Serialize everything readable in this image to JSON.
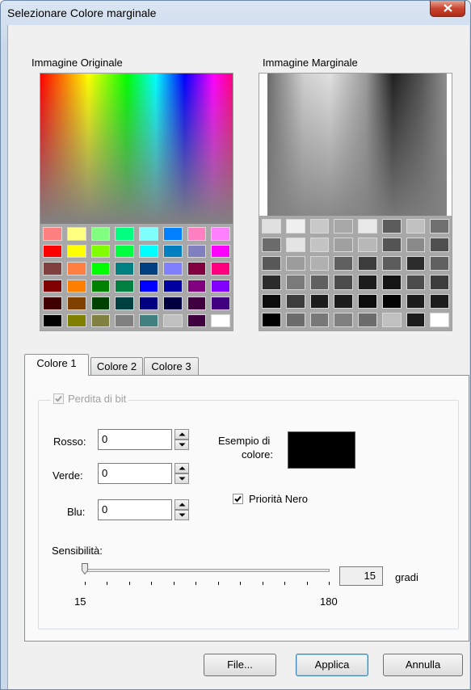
{
  "window": {
    "title": "Selezionare Colore marginale"
  },
  "images": {
    "original_label": "Immagine Originale",
    "marginal_label": "Immagine Marginale",
    "original_swatches": [
      [
        "#ff8080",
        "#ffff80",
        "#80ff80",
        "#00ff80",
        "#80ffff",
        "#0080ff",
        "#ff80c0",
        "#ff80ff"
      ],
      [
        "#ff0000",
        "#ffff00",
        "#80ff00",
        "#00ff40",
        "#00ffff",
        "#0080c0",
        "#8080c0",
        "#ff00ff"
      ],
      [
        "#804040",
        "#ff8040",
        "#00ff00",
        "#008080",
        "#004080",
        "#8080ff",
        "#800040",
        "#ff0080"
      ],
      [
        "#800000",
        "#ff8000",
        "#008000",
        "#008040",
        "#0000ff",
        "#0000a0",
        "#800080",
        "#8000ff"
      ],
      [
        "#400000",
        "#804000",
        "#004000",
        "#004040",
        "#000080",
        "#000040",
        "#400040",
        "#400080"
      ],
      [
        "#000000",
        "#808000",
        "#808040",
        "#808080",
        "#408080",
        "#c0c0c0",
        "#400040",
        "#ffffff"
      ]
    ],
    "marginal_swatches": [
      [
        "#e0e0e0",
        "#f0f0f0",
        "#c8c8c8",
        "#a8a8a8",
        "#e8e8e8",
        "#5c5c5c",
        "#c0c0c0",
        "#707070"
      ],
      [
        "#6c6c6c",
        "#e4e4e4",
        "#c4c4c4",
        "#a0a0a0",
        "#b8b8b8",
        "#545454",
        "#8a8a8a",
        "#505050"
      ],
      [
        "#585858",
        "#9c9c9c",
        "#b0b0b0",
        "#606060",
        "#3c3c3c",
        "#5c5c5c",
        "#2c2c2c",
        "#606060"
      ],
      [
        "#2c2c2c",
        "#7a7a7a",
        "#606060",
        "#4c4c4c",
        "#1c1c1c",
        "#141414",
        "#4c4c4c",
        "#3c3c3c"
      ],
      [
        "#0c0c0c",
        "#3c3c3c",
        "#1c1c1c",
        "#1c1c1c",
        "#0c0c0c",
        "#040404",
        "#1c1c1c",
        "#1c1c1c"
      ],
      [
        "#000000",
        "#6c6c6c",
        "#787878",
        "#808080",
        "#6c6c6c",
        "#c0c0c0",
        "#1c1c1c",
        "#ffffff"
      ]
    ]
  },
  "tabs": [
    {
      "label": "Colore 1",
      "active": true
    },
    {
      "label": "Colore 2",
      "active": false
    },
    {
      "label": "Colore 3",
      "active": false
    }
  ],
  "group": {
    "label": "Perdita di bit",
    "checked": true,
    "disabled": true
  },
  "fields": {
    "red_label": "Rosso:",
    "red_value": "0",
    "green_label": "Verde:",
    "green_value": "0",
    "blue_label": "Blu:",
    "blue_value": "0"
  },
  "sample": {
    "label_line1": "Esempio di",
    "label_line2": "colore:",
    "color": "#000000"
  },
  "black_priority": {
    "label": "Priorità Nero",
    "checked": true
  },
  "sensitivity": {
    "label": "Sensibilità:",
    "min_label": "15",
    "max_label": "180",
    "min": 15,
    "max": 180,
    "value": 15,
    "value_text": "15",
    "unit": "gradi"
  },
  "buttons": {
    "file": "File...",
    "apply": "Applica",
    "cancel": "Annulla"
  }
}
